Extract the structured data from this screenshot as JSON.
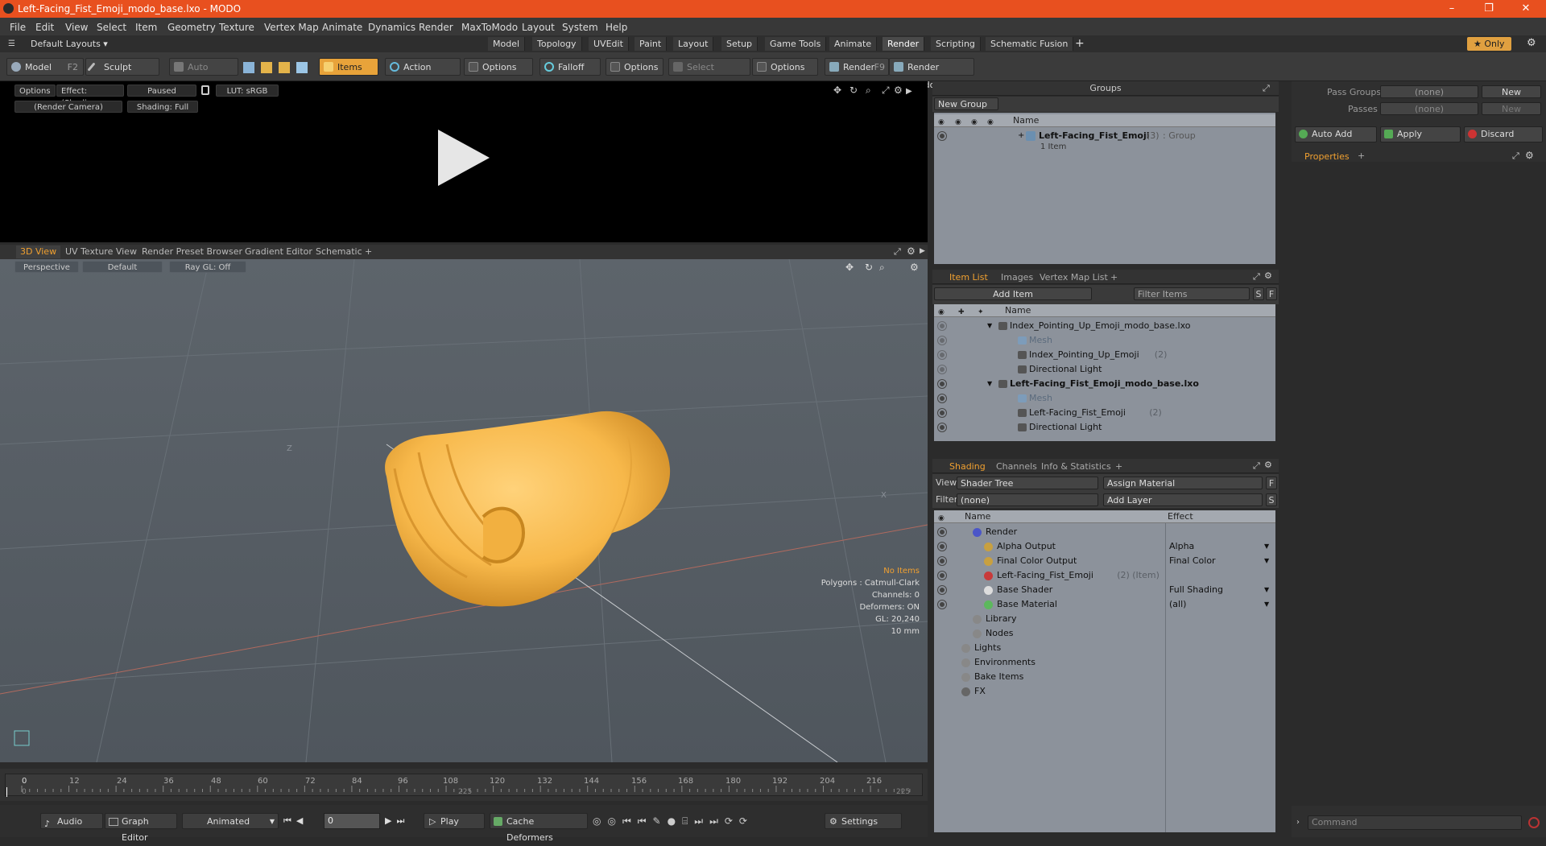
{
  "window": {
    "title": "Left-Facing_Fist_Emoji_modo_base.lxo - MODO",
    "minimize": "–",
    "maximize": "❐",
    "close": "✕"
  },
  "menu": [
    "File",
    "Edit",
    "View",
    "Select",
    "Item",
    "Geometry",
    "Texture",
    "Vertex Map",
    "Animate",
    "Dynamics",
    "Render",
    "MaxToModo",
    "Layout",
    "System",
    "Help"
  ],
  "layouts": {
    "selector": "Default Layouts ▾",
    "tabs": [
      "Model",
      "Topology",
      "UVEdit",
      "Paint",
      "Layout",
      "Setup",
      "Game Tools",
      "Animate",
      "Render",
      "Scripting",
      "Schematic Fusion"
    ],
    "active": "Render",
    "add": "+",
    "only": "★ Only"
  },
  "toolbar": {
    "model": "Model",
    "model_key": "F2",
    "sculpt": "Sculpt",
    "auto_select": "Auto Select",
    "items": "Items",
    "action_center": "Action Center",
    "options1": "Options",
    "falloff": "Falloff",
    "options2": "Options",
    "select_through": "Select Through",
    "options3": "Options",
    "render": "Render",
    "render_key": "F9",
    "render_window": "Render Window"
  },
  "render_view": {
    "options": "Options",
    "effect": "Effect: (Shadi...",
    "paused": "Paused",
    "lut": "LUT: sRGB",
    "camera": "(Render Camera)",
    "shading": "Shading: Full"
  },
  "viewport_tabs": [
    "3D View",
    "UV Texture View",
    "Render Preset Browser",
    "Gradient Editor",
    "Schematic",
    "+"
  ],
  "viewport": {
    "projection": "Perspective",
    "style": "Default",
    "raygl": "Ray GL: Off",
    "axis_z": "Z",
    "axis_x": "X"
  },
  "viewport_info": {
    "no_items": "No Items",
    "polygons": "Polygons : Catmull-Clark",
    "channels": "Channels: 0",
    "deformers": "Deformers: ON",
    "gl": "GL: 20,240",
    "unit": "10 mm"
  },
  "timeline": {
    "ticks": [
      "0",
      "12",
      "24",
      "36",
      "48",
      "60",
      "72",
      "84",
      "96",
      "108",
      "120",
      "132",
      "144",
      "156",
      "168",
      "180",
      "192",
      "204",
      "216"
    ],
    "start": "0",
    "mid": "225",
    "end": "225"
  },
  "bottom": {
    "audio": "Audio",
    "graph_editor": "Graph Editor",
    "animated": "Animated",
    "frame": "0",
    "play": "Play",
    "cache_deformers": "Cache Deformers",
    "settings": "Settings"
  },
  "groups": {
    "title": "Groups",
    "new_group": "New Group",
    "col_name": "Name",
    "group_name": "Left-Facing_Fist_Emoji",
    "group_count": "(3)",
    "group_type": ": Group",
    "group_items": "1 Item"
  },
  "pass": {
    "pass_groups_label": "Pass Groups",
    "pass_groups_value": "(none)",
    "passes_label": "Passes",
    "passes_value": "(none)",
    "new1": "New",
    "new2": "New",
    "auto_add": "Auto Add",
    "apply": "Apply",
    "discard": "Discard",
    "properties": "Properties",
    "add": "+"
  },
  "itemlist": {
    "tabs": [
      "Item List",
      "Images",
      "Vertex Map List",
      "+"
    ],
    "add_item": "Add Item",
    "filter_items": "Filter Items",
    "s": "S",
    "f": "F",
    "col_name": "Name",
    "rows": [
      {
        "label": "Index_Pointing_Up_Emoji_modo_base.lxo",
        "count": "",
        "indent": 0,
        "bold": false,
        "dim": false
      },
      {
        "label": "Mesh",
        "count": "",
        "indent": 2,
        "bold": false,
        "dim": true
      },
      {
        "label": "Index_Pointing_Up_Emoji",
        "count": "(2)",
        "indent": 2,
        "bold": false,
        "dim": false
      },
      {
        "label": "Directional Light",
        "count": "",
        "indent": 2,
        "bold": false,
        "dim": false
      },
      {
        "label": "Left-Facing_Fist_Emoji_modo_base.lxo",
        "count": "",
        "indent": 0,
        "bold": true,
        "dim": false
      },
      {
        "label": "Mesh",
        "count": "",
        "indent": 2,
        "bold": false,
        "dim": true
      },
      {
        "label": "Left-Facing_Fist_Emoji",
        "count": "(2)",
        "indent": 2,
        "bold": false,
        "dim": false
      },
      {
        "label": "Directional Light",
        "count": "",
        "indent": 2,
        "bold": false,
        "dim": false
      }
    ]
  },
  "shading": {
    "tabs": [
      "Shading",
      "Channels",
      "Info & Statistics",
      "+"
    ],
    "view_label": "View",
    "view_value": "Shader Tree",
    "assign_material": "Assign Material",
    "filter_label": "Filter",
    "filter_value": "(none)",
    "add_layer": "Add Layer",
    "f": "F",
    "s": "S",
    "col_name": "Name",
    "col_effect": "Effect",
    "rows": [
      {
        "label": "Render",
        "effect": "",
        "indent": 1,
        "dim": ""
      },
      {
        "label": "Alpha Output",
        "effect": "Alpha",
        "indent": 2,
        "dim": ""
      },
      {
        "label": "Final Color Output",
        "effect": "Final Color",
        "indent": 2,
        "dim": ""
      },
      {
        "label": "Left-Facing_Fist_Emoji",
        "effect": "",
        "indent": 2,
        "dim": "(2) (Item)"
      },
      {
        "label": "Base Shader",
        "effect": "Full Shading",
        "indent": 2,
        "dim": ""
      },
      {
        "label": "Base Material",
        "effect": "(all)",
        "indent": 2,
        "dim": ""
      },
      {
        "label": "Library",
        "effect": "",
        "indent": 1,
        "dim": ""
      },
      {
        "label": "Nodes",
        "effect": "",
        "indent": 1,
        "dim": ""
      },
      {
        "label": "Lights",
        "effect": "",
        "indent": 0,
        "dim": ""
      },
      {
        "label": "Environments",
        "effect": "",
        "indent": 0,
        "dim": ""
      },
      {
        "label": "Bake Items",
        "effect": "",
        "indent": 0,
        "dim": ""
      },
      {
        "label": "FX",
        "effect": "",
        "indent": 0,
        "dim": ""
      }
    ]
  },
  "command": {
    "placeholder": "Command"
  },
  "colors": {
    "accent": "#f0a030",
    "title_bar": "#e8501f",
    "skin": "#f7b84a"
  }
}
